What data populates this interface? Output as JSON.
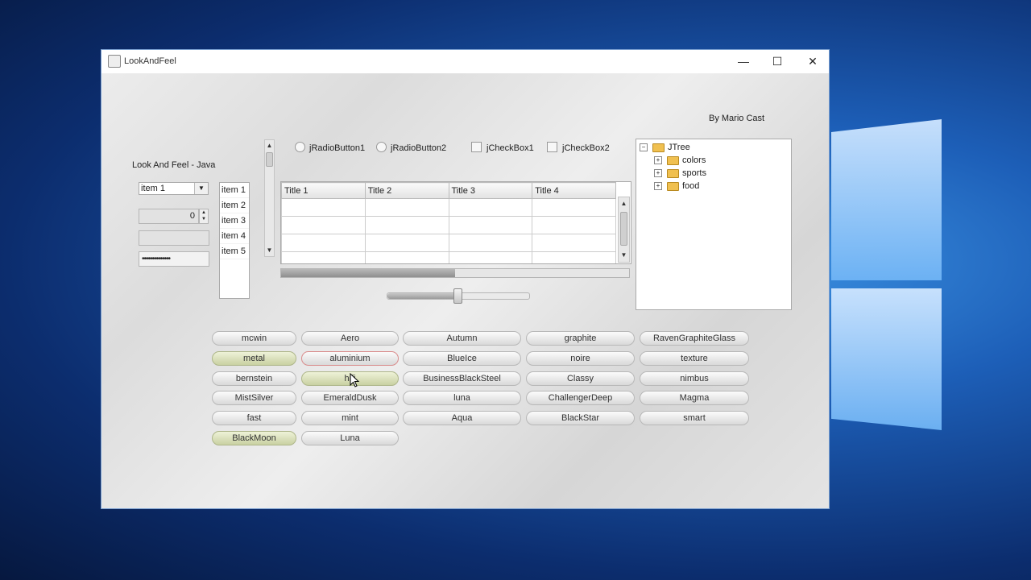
{
  "window": {
    "title": "LookAndFeel",
    "controls": {
      "minimize": "—",
      "maximize": "☐",
      "close": "✕"
    }
  },
  "author": "By Mario Cast",
  "heading": "Look And Feel - Java",
  "combo": {
    "value": "item 1"
  },
  "spinner": {
    "value": "0"
  },
  "password": {
    "value": "••••••••••••••"
  },
  "list": {
    "items": [
      "item 1",
      "item 2",
      "item 3",
      "item 4",
      "item 5"
    ]
  },
  "radios": [
    {
      "label": "jRadioButton1"
    },
    {
      "label": "jRadioButton2"
    }
  ],
  "checkboxes": [
    {
      "label": "jCheckBox1"
    },
    {
      "label": "jCheckBox2"
    }
  ],
  "table": {
    "columns": [
      "Title 1",
      "Title 2",
      "Title 3",
      "Title 4"
    ],
    "row_count": 4
  },
  "progress": {
    "value": 0.5
  },
  "slider": {
    "value": 0.5
  },
  "tree": {
    "root": "JTree",
    "children": [
      "colors",
      "sports",
      "food"
    ]
  },
  "themes": {
    "col1": [
      "mcwin",
      "metal",
      "bernstein",
      "MistSilver",
      "fast",
      "BlackMoon"
    ],
    "col2": [
      "Aero",
      "aluminium",
      "hifi",
      "EmeraldDusk",
      "mint",
      "Luna"
    ],
    "col3": [
      "Autumn",
      "BlueIce",
      "BusinessBlackSteel",
      "luna",
      "Aqua"
    ],
    "col4": [
      "graphite",
      "noire",
      "Classy",
      "ChallengerDeep",
      "BlackStar"
    ],
    "col5": [
      "RavenGraphiteGlass",
      "texture",
      "nimbus",
      "Magma",
      "smart"
    ]
  },
  "colors": {
    "accent_selected": "#c9d1a2",
    "desktop": "#1d5fb8"
  }
}
